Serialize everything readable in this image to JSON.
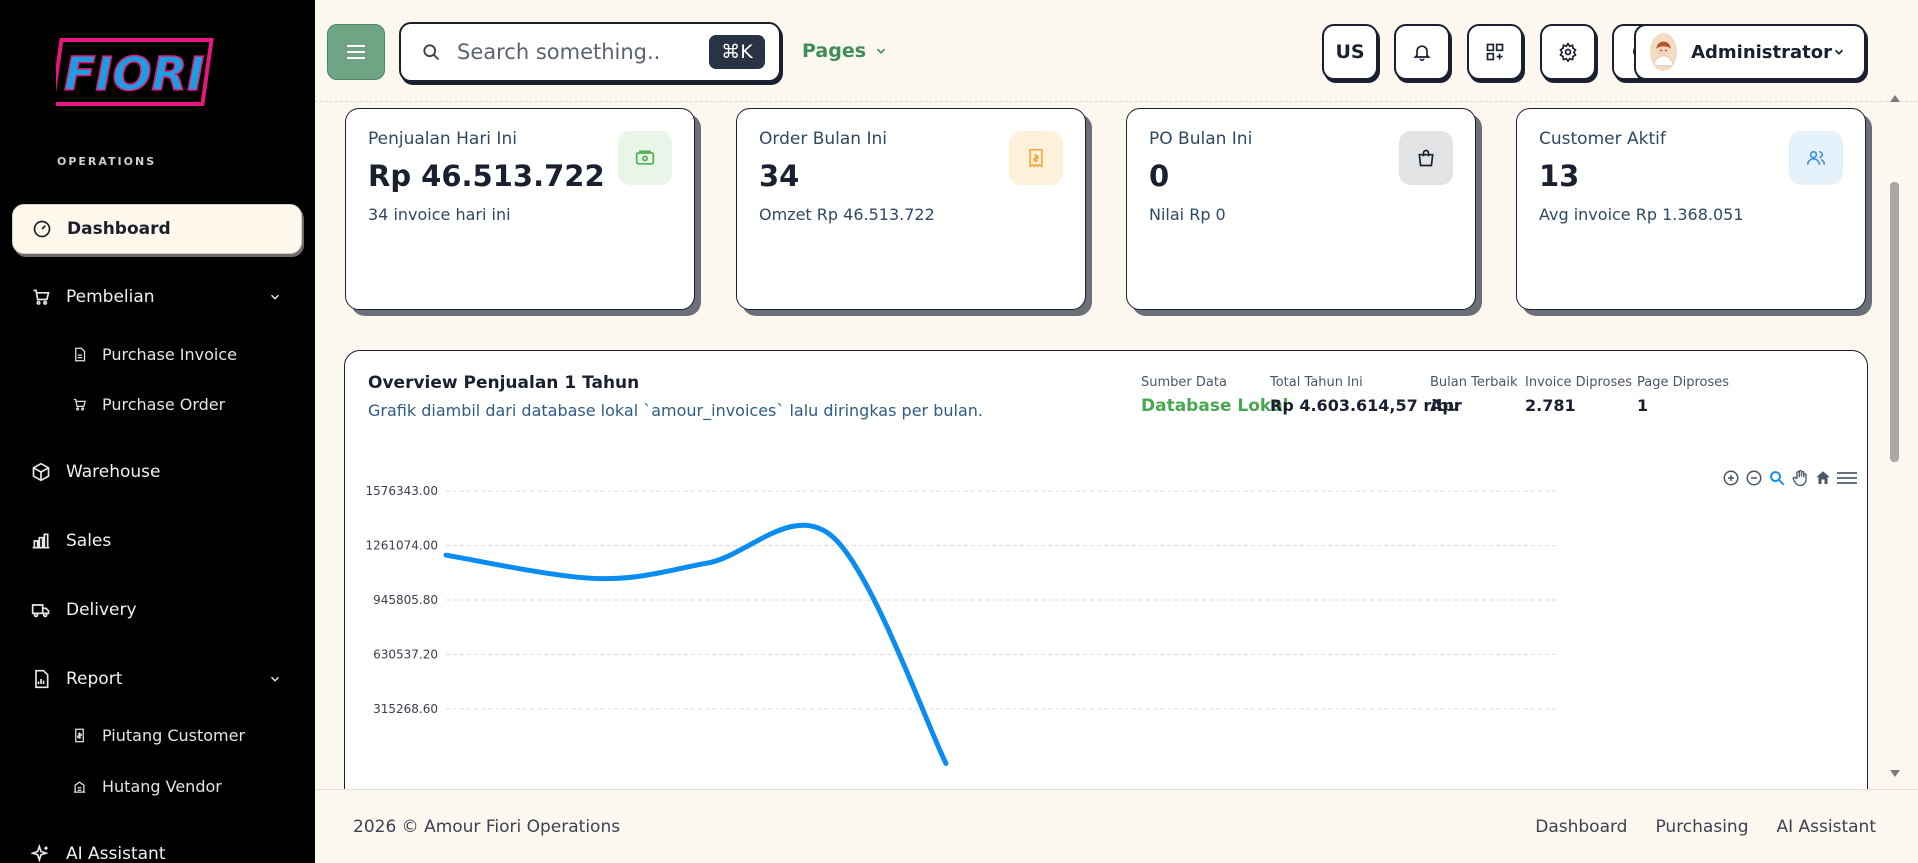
{
  "sidebar": {
    "brand": "FIORI",
    "section": "OPERATIONS",
    "items": [
      {
        "label": "Dashboard"
      },
      {
        "label": "Pembelian"
      },
      {
        "label": "Purchase Invoice"
      },
      {
        "label": "Purchase Order"
      },
      {
        "label": "Warehouse"
      },
      {
        "label": "Sales"
      },
      {
        "label": "Delivery"
      },
      {
        "label": "Report"
      },
      {
        "label": "Piutang Customer"
      },
      {
        "label": "Hutang Vendor"
      },
      {
        "label": "AI Assistant"
      }
    ]
  },
  "topbar": {
    "search_placeholder": "Search something..",
    "shortcut": "⌘K",
    "pages_label": "Pages",
    "lang": "US",
    "user_name": "Administrator"
  },
  "stats": [
    {
      "title": "Penjualan Hari Ini",
      "value": "Rp 46.513.722",
      "sub": "34 invoice hari ini",
      "color": "#4caf50"
    },
    {
      "title": "Order Bulan Ini",
      "value": "34",
      "sub": "Omzet Rp 46.513.722",
      "color": "#f2a93b"
    },
    {
      "title": "PO Bulan Ini",
      "value": "0",
      "sub": "Nilai Rp 0",
      "color": "#1b2030"
    },
    {
      "title": "Customer Aktif",
      "value": "13",
      "sub": "Avg invoice Rp 1.368.051",
      "color": "#4a90d9"
    }
  ],
  "overview": {
    "title": "Overview Penjualan 1 Tahun",
    "description": "Grafik diambil dari database lokal `amour_invoices` lalu diringkas per bulan.",
    "meta": [
      {
        "label": "Sumber Data",
        "value": "Database Lokal"
      },
      {
        "label": "Total Tahun Ini",
        "value": "Rp 4.603.614,57 ribu"
      },
      {
        "label": "Bulan Terbaik",
        "value": "Apr"
      },
      {
        "label": "Invoice Diproses",
        "value": "2.781"
      },
      {
        "label": "Page Diproses",
        "value": "1"
      }
    ]
  },
  "chart_data": {
    "type": "line",
    "x_index": [
      0,
      1,
      2,
      3,
      4
    ],
    "values": [
      1205000,
      1070000,
      1160000,
      1315000,
      0
    ],
    "ylim": [
      0,
      1576343
    ],
    "y_ticks": [
      "1576343.00",
      "1261074.00",
      "945805.80",
      "630537.20",
      "315268.60"
    ],
    "y_tick_values": [
      1576343.0,
      1261074.0,
      945805.8,
      630537.2,
      315268.6
    ],
    "grid": true,
    "line_color": "#0b8cf0"
  },
  "footer": {
    "copyright": "2026 © Amour Fiori Operations",
    "links": [
      "Dashboard",
      "Purchasing",
      "AI Assistant"
    ]
  }
}
